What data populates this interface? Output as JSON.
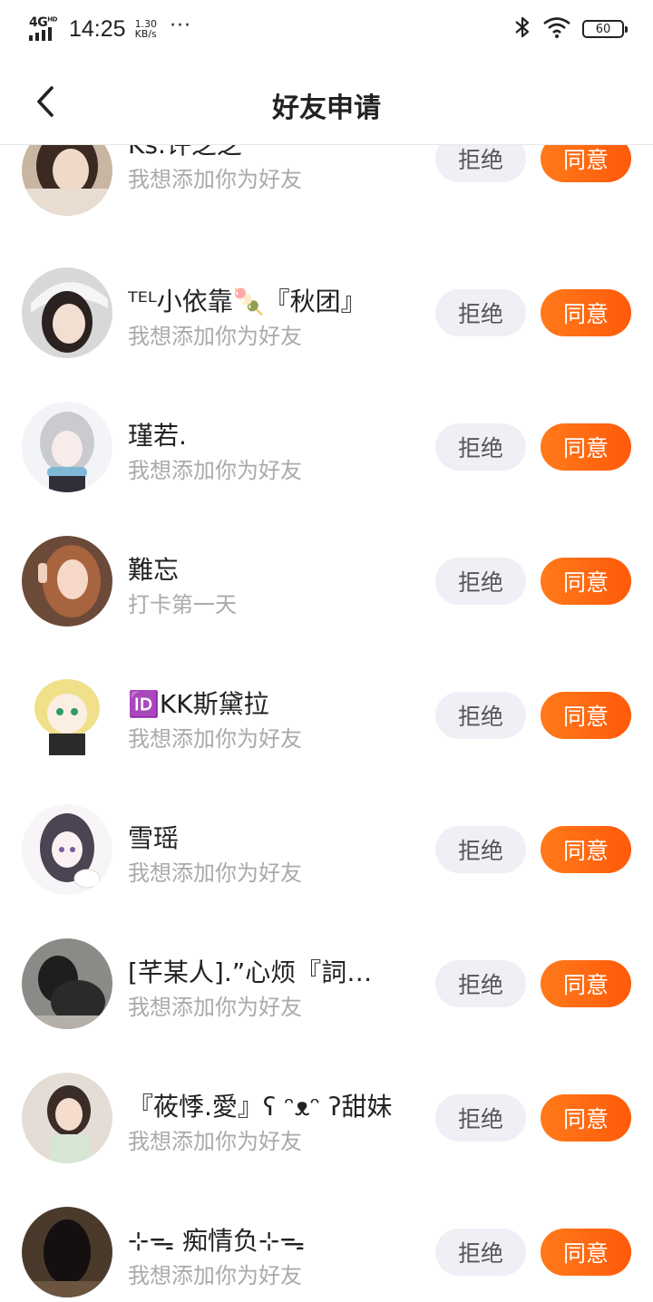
{
  "status_bar": {
    "network": "4G",
    "network_sup": "HD",
    "time": "14:25",
    "speed_value": "1.30",
    "speed_unit": "KB/s",
    "more": "···",
    "battery": "60"
  },
  "header": {
    "title": "好友申请"
  },
  "requests": [
    {
      "name": "Ks.许芝芝",
      "message": "我想添加你为好友"
    },
    {
      "name": "ᵀᴱᴸ小依靠🍡『秋团』",
      "message": "我想添加你为好友"
    },
    {
      "name": "瑾若.",
      "message": "我想添加你为好友"
    },
    {
      "name": "難忘",
      "message": "打卡第一天"
    },
    {
      "name": "🆔KK斯黛拉",
      "message": "我想添加你为好友"
    },
    {
      "name": "雪瑶",
      "message": "我想添加你为好友"
    },
    {
      "name": "[芊某人].”心烦『詞…",
      "message": "我想添加你为好友"
    },
    {
      "name": "『莜悸.愛』ʕ ᵔᴥᵔ ʔ甜妹",
      "message": "我想添加你为好友"
    },
    {
      "name": "⊹ᯓ 痴情负⊹ᯓ",
      "message": "我想添加你为好友"
    }
  ],
  "buttons": {
    "reject_label": "拒绝",
    "agree_label": "同意"
  },
  "colors": {
    "accent": "#ff6a10",
    "reject_bg": "#eef0f5",
    "secondary_text": "#aaaaaa"
  },
  "icons": {
    "back": "chevron-left-icon",
    "bluetooth": "bluetooth-icon",
    "wifi": "wifi-icon",
    "battery": "battery-icon",
    "signal": "signal-icon"
  }
}
